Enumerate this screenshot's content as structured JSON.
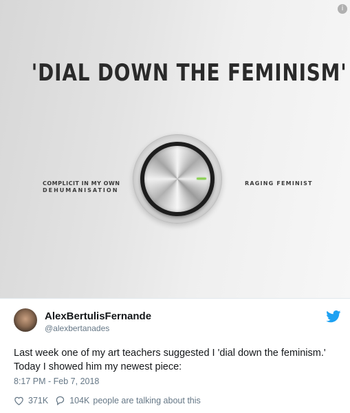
{
  "media": {
    "title": "'DIAL  DOWN  THE  FEMINISM'",
    "left_label_line1": "COMPLICIT IN MY OWN",
    "left_label_line2": "DEHUMANISATION",
    "right_label": "RAGING FEMINIST",
    "info_icon": "info-icon",
    "info_glyph": "i"
  },
  "tweet": {
    "display_name": "AlexBertulisFernande",
    "handle": "@alexbertanades",
    "text": "Last week one of my art teachers suggested I 'dial down the feminism.' Today I showed him my newest piece:",
    "timestamp": "8:17 PM - Feb 7, 2018",
    "likes": "371K",
    "replies": "104K",
    "talking_text": "people are talking about this"
  },
  "colors": {
    "twitter_blue": "#1da1f2",
    "text_primary": "#14171a",
    "text_secondary": "#657786",
    "dial_marker": "#8fd05a"
  }
}
